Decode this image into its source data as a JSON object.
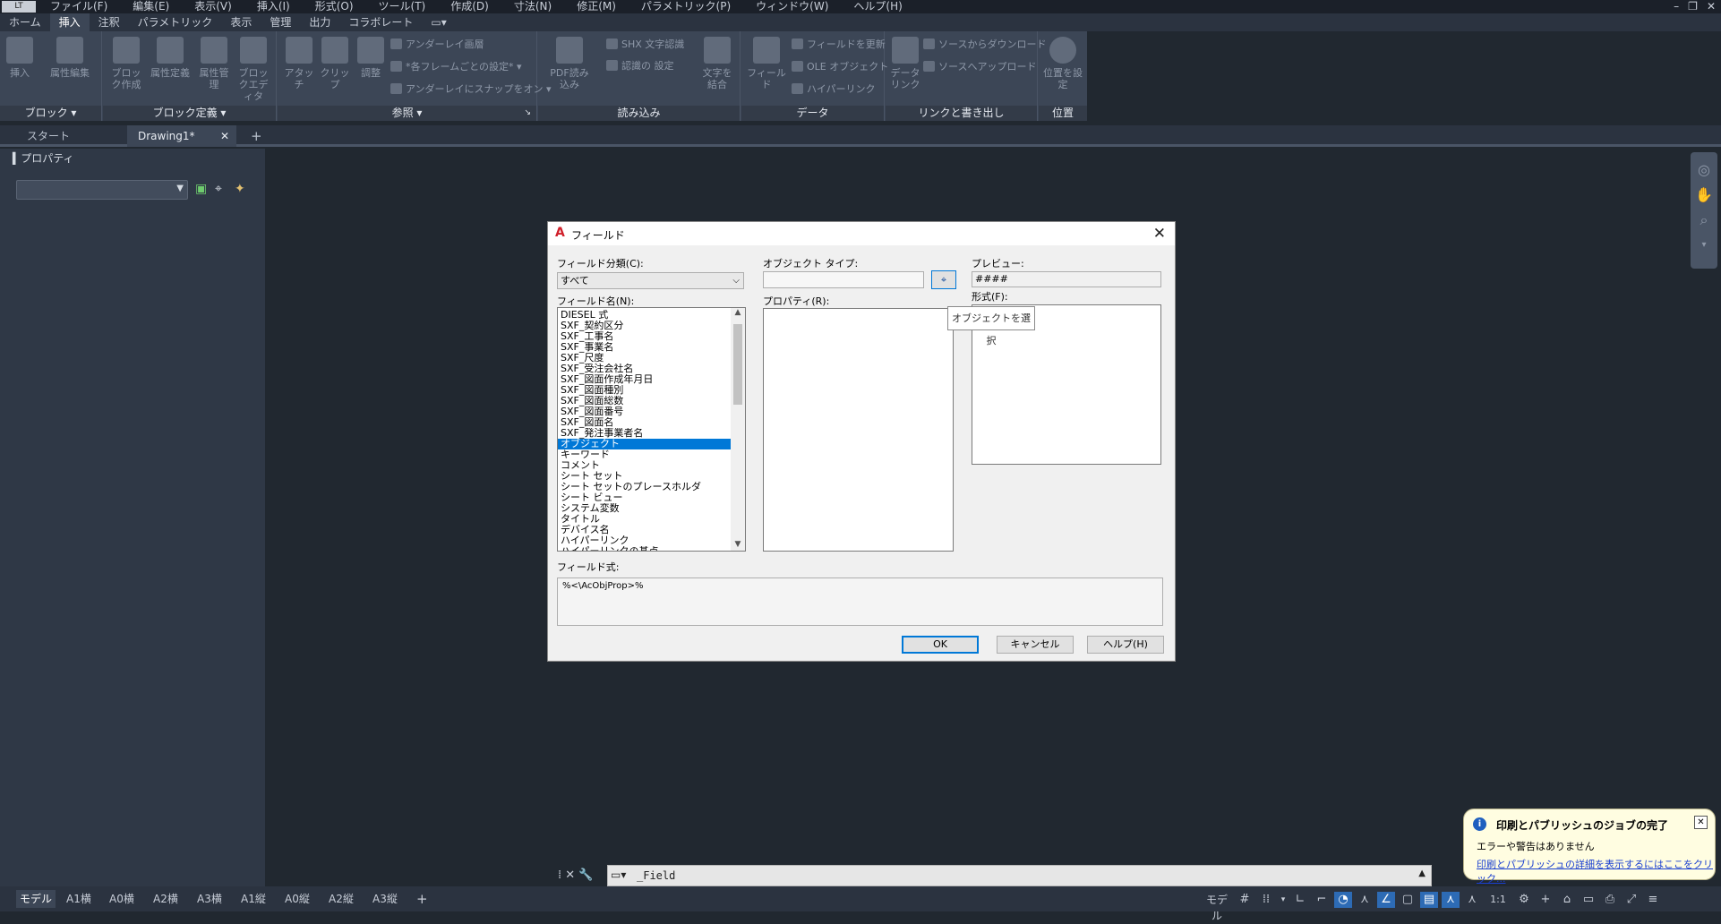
{
  "app_badge": "LT",
  "menu": [
    "ファイル(F)",
    "編集(E)",
    "表示(V)",
    "挿入(I)",
    "形式(O)",
    "ツール(T)",
    "作成(D)",
    "寸法(N)",
    "修正(M)",
    "パラメトリック(P)",
    "ウィンドウ(W)",
    "ヘルプ(H)"
  ],
  "ribbon_tabs": [
    "ホーム",
    "挿入",
    "注釈",
    "パラメトリック",
    "表示",
    "管理",
    "出力",
    "コラボレート"
  ],
  "ribbon_active_tab": "挿入",
  "ribbon": {
    "block": {
      "title": "ブロック ▾",
      "insert": "挿入",
      "attr_edit": "属性編集"
    },
    "block_def": {
      "title": "ブロック定義 ▾",
      "create": "ブロック作成",
      "define_attr": "属性定義",
      "manage_attr": "属性管理",
      "block_editor": "ブロックエディタ"
    },
    "reference": {
      "title": "参照 ▾",
      "attach": "アタッチ",
      "clip": "クリップ",
      "adjust": "調整",
      "underlay_layer": "アンダーレイ画層",
      "frame_setting": "*各フレームごとの設定*",
      "snap_underlay": "アンダーレイにスナップをオン"
    },
    "import": {
      "title": "読み込み",
      "pdf_import": "PDF読み込み",
      "shx": "SHX 文字認識",
      "recog_setting": "認識の 設定",
      "text_combine": "文字を結合"
    },
    "data": {
      "title": "データ",
      "field": "フィールド",
      "update_fields": "フィールドを更新",
      "ole": "OLE オブジェクト",
      "hyperlink": "ハイパーリンク"
    },
    "link": {
      "title": "リンクと書き出し",
      "data_link": "データリンク",
      "download_source": "ソースからダウンロード",
      "upload_source": "ソースへアップロード"
    },
    "location": {
      "title": "位置",
      "set_location": "位置を設定"
    }
  },
  "doc_tabs": {
    "start": "スタート",
    "drawing": "Drawing1*"
  },
  "properties_palette": {
    "title": "プロパティ"
  },
  "dialog": {
    "title": "フィールド",
    "category_label": "フィールド分類(C):",
    "category_value": "すべて",
    "names_label": "フィールド名(N):",
    "names": [
      "DIESEL 式",
      "SXF_契約区分",
      "SXF_工事名",
      "SXF_事業名",
      "SXF_尺度",
      "SXF_受注会社名",
      "SXF_図面作成年月日",
      "SXF_図面種別",
      "SXF_図面総数",
      "SXF_図面番号",
      "SXF_図面名",
      "SXF_発注事業者名",
      "オブジェクト",
      "キーワード",
      "コメント",
      "シート セット",
      "シート セットのプレースホルダ",
      "シート ビュー",
      "システム変数",
      "タイトル",
      "デバイス名",
      "ハイパーリンク",
      "ハイパーリンクの基点"
    ],
    "selected_name": "オブジェクト",
    "object_type_label": "オブジェクト タイプ:",
    "properties_label": "プロパティ(R):",
    "preview_label": "プレビュー:",
    "preview_value": "####",
    "format_label": "形式(F):",
    "tooltip": "オブジェクトを選択",
    "expression_label": "フィールド式:",
    "expression_value": "%<\\AcObjProp>%",
    "ok": "OK",
    "cancel": "キャンセル",
    "help": "ヘルプ(H)"
  },
  "command_line": "_Field",
  "layout_tabs": [
    "モデル",
    "A1横",
    "A0横",
    "A2横",
    "A3横",
    "A1縦",
    "A0縦",
    "A2縦",
    "A3縦"
  ],
  "status": {
    "model": "モデル",
    "scale": "1:1"
  },
  "notification": {
    "title": "印刷とパブリッシュのジョブの完了",
    "line1": "エラーや警告はありません",
    "link": "印刷とパブリッシュの詳細を表示するにはここをクリック..."
  },
  "colors": {
    "background": "#212830",
    "ribbon": "#3c4656",
    "selection": "#0078d7",
    "status_active": "#2d6bb5",
    "balloon": "#fffde1"
  }
}
